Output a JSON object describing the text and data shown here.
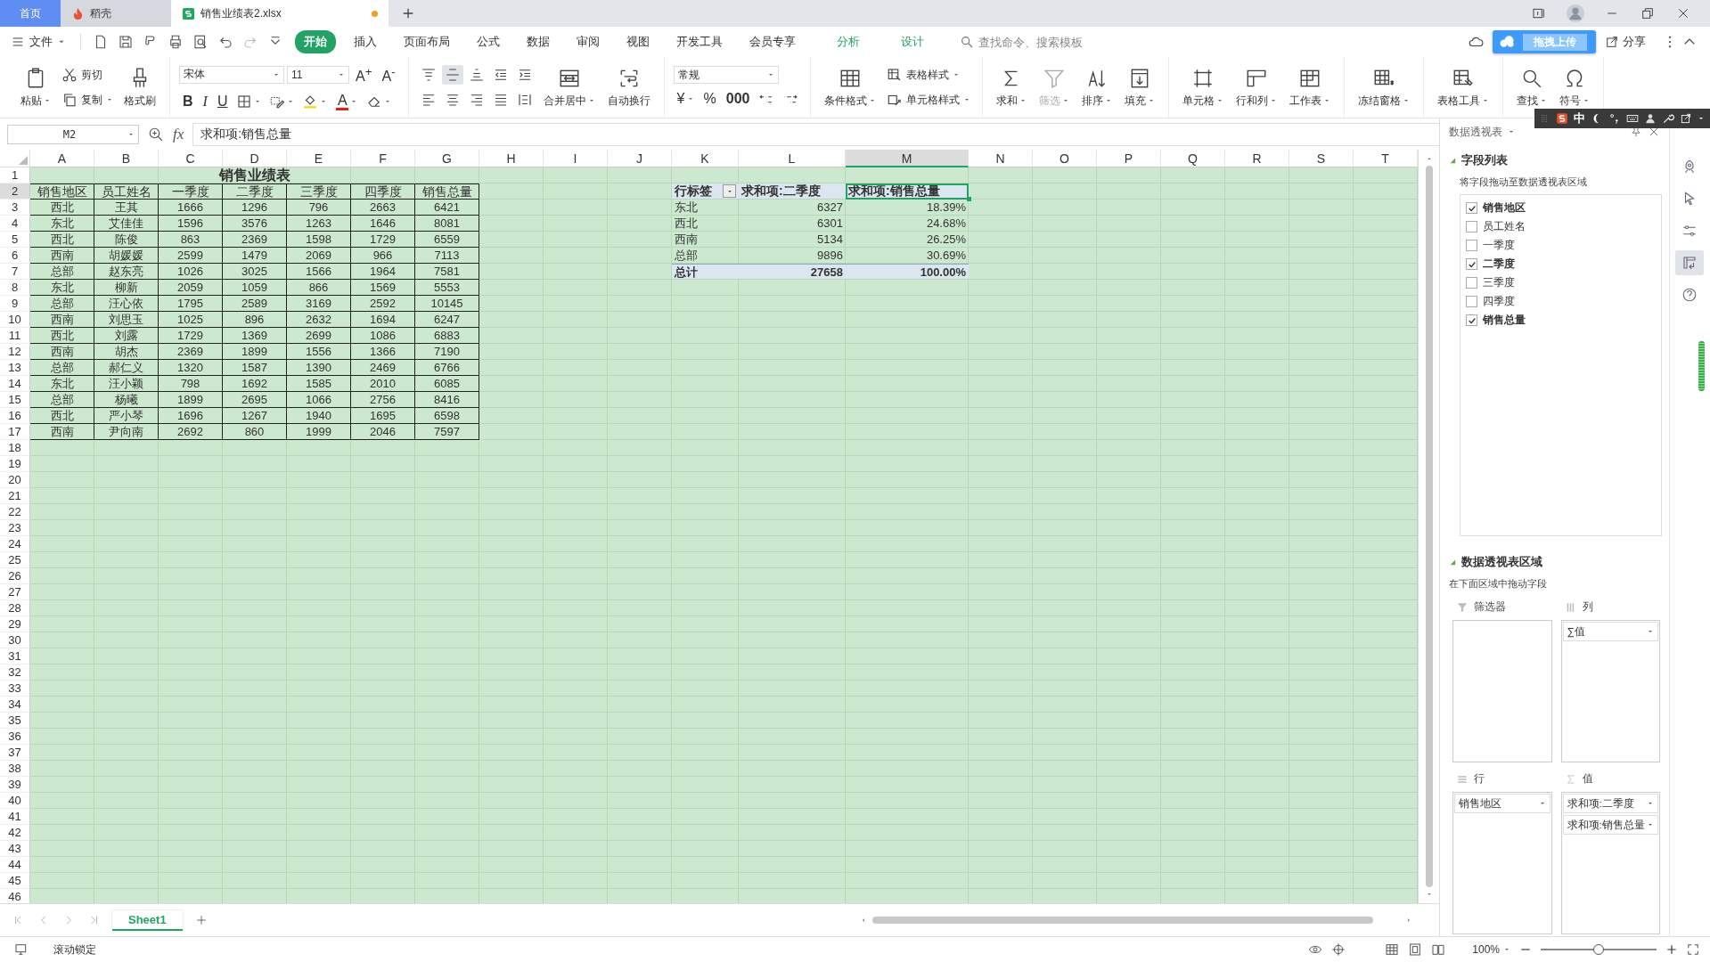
{
  "tabs": [
    {
      "label": "首页",
      "kind": "home",
      "selected": false
    },
    {
      "label": "稻壳",
      "kind": "docer",
      "selected": false
    },
    {
      "label": "销售业绩表2.xlsx",
      "kind": "sheet",
      "selected": true,
      "modified": true
    }
  ],
  "menu": {
    "file": "文件",
    "tabs": [
      {
        "label": "开始",
        "kind": "main",
        "selected": true
      },
      {
        "label": "插入",
        "kind": "main",
        "selected": false
      },
      {
        "label": "页面布局",
        "kind": "main",
        "selected": false
      },
      {
        "label": "公式",
        "kind": "main",
        "selected": false
      },
      {
        "label": "数据",
        "kind": "main",
        "selected": false
      },
      {
        "label": "审阅",
        "kind": "main",
        "selected": false
      },
      {
        "label": "视图",
        "kind": "main",
        "selected": false
      },
      {
        "label": "开发工具",
        "kind": "main",
        "selected": false
      },
      {
        "label": "会员专享",
        "kind": "main",
        "selected": false
      },
      {
        "label": "分析",
        "kind": "context",
        "selected": false
      },
      {
        "label": "设计",
        "kind": "context",
        "selected": false
      }
    ],
    "search": {
      "placeholder": "查找命令、搜索模板"
    },
    "upload": "拖拽上传",
    "share": "分享"
  },
  "ribbon": {
    "groups": [
      {
        "stacks": [
          [
            [
              {
                "kind": "large",
                "label": "粘贴",
                "dropdown": true
              }
            ]
          ],
          [
            [
              {
                "kind": "small",
                "label": "剪切",
                "dropdown": false
              }
            ],
            [
              {
                "kind": "small",
                "label": "复制",
                "dropdown": true
              }
            ]
          ],
          [
            [
              {
                "kind": "large",
                "label": "格式刷",
                "dropdown": false
              }
            ]
          ]
        ]
      },
      {
        "stacks": [
          [
            [
              {
                "kind": "select",
                "label": "宋体",
                "wide": true
              },
              {
                "kind": "select",
                "label": "11",
                "wide": false
              },
              {
                "kind": "char",
                "label": "A$^{+}$"
              },
              {
                "kind": "char",
                "label": "A$^{-}$"
              }
            ],
            [
              {
                "kind": "char",
                "label": "B"
              },
              {
                "kind": "char",
                "label": "I"
              },
              {
                "kind": "char",
                "label": "U"
              },
              {
                "kind": "icon",
                "dropdown": true
              },
              {
                "kind": "icon",
                "dropdown": true
              },
              {
                "kind": "icon",
                "dropdown": true
              },
              {
                "kind": "char",
                "label": "A",
                "color": "#e02020",
                "dropdown": true
              },
              {
                "kind": "icon",
                "dropdown": true
              }
            ]
          ]
        ]
      },
      {
        "stacks": [
          [
            [
              {
                "kind": "icon",
                "on": false
              },
              {
                "kind": "icon",
                "on": true
              },
              {
                "kind": "icon",
                "on": false
              },
              {
                "kind": "icon",
                "on": false
              },
              {
                "kind": "icon",
                "on": false
              }
            ],
            [
              {
                "kind": "icon",
                "on": false
              },
              {
                "kind": "icon",
                "on": false
              },
              {
                "kind": "icon",
                "on": false
              },
              {
                "kind": "icon",
                "on": false
              },
              {
                "kind": "icon",
                "on": false
              }
            ]
          ],
          [
            [
              {
                "kind": "large",
                "label": "合并居中",
                "dropdown": true
              }
            ]
          ],
          [
            [
              {
                "kind": "large",
                "label": "自动换行",
                "dropdown": false
              }
            ]
          ]
        ]
      },
      {
        "stacks": [
          [
            [
              {
                "kind": "select",
                "label": "常规",
                "wide": true
              }
            ],
            [
              {
                "kind": "char",
                "label": "¥",
                "dropdown": true
              },
              {
                "kind": "char",
                "label": "%"
              },
              {
                "kind": "char",
                "label": "000"
              },
              {
                "kind": "icon"
              },
              {
                "kind": "icon"
              }
            ]
          ]
        ]
      },
      {
        "stacks": [
          [
            [
              {
                "kind": "large",
                "label": "条件格式",
                "dropdown": true
              }
            ]
          ],
          [
            [
              {
                "kind": "small",
                "label": "表格样式",
                "dropdown": true
              }
            ],
            [
              {
                "kind": "small",
                "label": "单元格样式",
                "dropdown": true
              }
            ]
          ]
        ]
      },
      {
        "stacks": [
          [
            [
              {
                "kind": "large",
                "label": "求和",
                "dropdown": true,
                "disabled": false
              }
            ]
          ],
          [
            [
              {
                "kind": "large",
                "label": "筛选",
                "dropdown": true,
                "disabled": true
              }
            ]
          ],
          [
            [
              {
                "kind": "large",
                "label": "排序",
                "dropdown": true,
                "disabled": false
              }
            ]
          ],
          [
            [
              {
                "kind": "large",
                "label": "填充",
                "dropdown": true,
                "disabled": false
              }
            ]
          ]
        ]
      },
      {
        "stacks": [
          [
            [
              {
                "kind": "large",
                "label": "单元格",
                "dropdown": true
              }
            ]
          ],
          [
            [
              {
                "kind": "large",
                "label": "行和列",
                "dropdown": true
              }
            ]
          ],
          [
            [
              {
                "kind": "large",
                "label": "工作表",
                "dropdown": true
              }
            ]
          ]
        ]
      },
      {
        "stacks": [
          [
            [
              {
                "kind": "large",
                "label": "冻结窗格",
                "dropdown": true
              }
            ]
          ]
        ]
      },
      {
        "stacks": [
          [
            [
              {
                "kind": "large",
                "label": "表格工具",
                "dropdown": true
              }
            ]
          ]
        ]
      },
      {
        "stacks": [
          [
            [
              {
                "kind": "large",
                "label": "查找",
                "dropdown": true
              }
            ]
          ],
          [
            [
              {
                "kind": "large",
                "label": "符号",
                "dropdown": true
              }
            ]
          ]
        ]
      }
    ]
  },
  "formula_bar": {
    "cell": "M2",
    "fx": "fx",
    "value": "求和项:销售总量"
  },
  "sheet": {
    "columns": [
      {
        "label": "A",
        "selected": false
      },
      {
        "label": "B",
        "selected": false
      },
      {
        "label": "C",
        "selected": false
      },
      {
        "label": "D",
        "selected": false
      },
      {
        "label": "E",
        "selected": false
      },
      {
        "label": "F",
        "selected": false
      },
      {
        "label": "G",
        "selected": false
      },
      {
        "label": "H",
        "selected": false
      },
      {
        "label": "I",
        "selected": false
      },
      {
        "label": "J",
        "selected": false
      },
      {
        "label": "K",
        "selected": false
      },
      {
        "label": "L",
        "selected": false
      },
      {
        "label": "M",
        "selected": true
      },
      {
        "label": "N",
        "selected": false
      },
      {
        "label": "O",
        "selected": false
      },
      {
        "label": "P",
        "selected": false
      },
      {
        "label": "Q",
        "selected": false
      },
      {
        "label": "R",
        "selected": false
      },
      {
        "label": "S",
        "selected": false
      },
      {
        "label": "T",
        "selected": false
      }
    ],
    "rows": [
      {
        "label": "1",
        "selected": false
      },
      {
        "label": "2",
        "selected": true
      },
      {
        "label": "3",
        "selected": false
      },
      {
        "label": "4",
        "selected": false
      },
      {
        "label": "5",
        "selected": false
      },
      {
        "label": "6",
        "selected": false
      },
      {
        "label": "7",
        "selected": false
      },
      {
        "label": "8",
        "selected": false
      },
      {
        "label": "9",
        "selected": false
      },
      {
        "label": "10",
        "selected": false
      },
      {
        "label": "11",
        "selected": false
      },
      {
        "label": "12",
        "selected": false
      },
      {
        "label": "13",
        "selected": false
      },
      {
        "label": "14",
        "selected": false
      },
      {
        "label": "15",
        "selected": false
      },
      {
        "label": "16",
        "selected": false
      },
      {
        "label": "17",
        "selected": false
      },
      {
        "label": "18",
        "selected": false
      },
      {
        "label": "19",
        "selected": false
      },
      {
        "label": "20",
        "selected": false
      },
      {
        "label": "21",
        "selected": false
      },
      {
        "label": "22",
        "selected": false
      },
      {
        "label": "23",
        "selected": false
      },
      {
        "label": "24",
        "selected": false
      },
      {
        "label": "25",
        "selected": false
      },
      {
        "label": "26",
        "selected": false
      },
      {
        "label": "27",
        "selected": false
      },
      {
        "label": "28",
        "selected": false
      },
      {
        "label": "29",
        "selected": false
      },
      {
        "label": "30",
        "selected": false
      },
      {
        "label": "31",
        "selected": false
      },
      {
        "label": "32",
        "selected": false
      },
      {
        "label": "33",
        "selected": false
      },
      {
        "label": "34",
        "selected": false
      },
      {
        "label": "35",
        "selected": false
      },
      {
        "label": "36",
        "selected": false
      },
      {
        "label": "37",
        "selected": false
      },
      {
        "label": "38",
        "selected": false
      },
      {
        "label": "39",
        "selected": false
      },
      {
        "label": "40",
        "selected": false
      },
      {
        "label": "41",
        "selected": false
      },
      {
        "label": "42",
        "selected": false
      },
      {
        "label": "43",
        "selected": false
      },
      {
        "label": "44",
        "selected": false
      },
      {
        "label": "45",
        "selected": false
      },
      {
        "label": "46",
        "selected": false
      }
    ]
  },
  "table": {
    "title": "销售业绩表",
    "columns": [
      "销售地区",
      "员工姓名",
      "一季度",
      "二季度",
      "三季度",
      "四季度",
      "销售总量"
    ],
    "rows": [
      [
        "西北",
        "王其",
        "1666",
        "1296",
        "796",
        "2663",
        "6421"
      ],
      [
        "东北",
        "艾佳佳",
        "1596",
        "3576",
        "1263",
        "1646",
        "8081"
      ],
      [
        "西北",
        "陈俊",
        "863",
        "2369",
        "1598",
        "1729",
        "6559"
      ],
      [
        "西南",
        "胡媛媛",
        "2599",
        "1479",
        "2069",
        "966",
        "7113"
      ],
      [
        "总部",
        "赵东亮",
        "1026",
        "3025",
        "1566",
        "1964",
        "7581"
      ],
      [
        "东北",
        "柳新",
        "2059",
        "1059",
        "866",
        "1569",
        "5553"
      ],
      [
        "总部",
        "汪心依",
        "1795",
        "2589",
        "3169",
        "2592",
        "10145"
      ],
      [
        "西南",
        "刘思玉",
        "1025",
        "896",
        "2632",
        "1694",
        "6247"
      ],
      [
        "西北",
        "刘露",
        "1729",
        "1369",
        "2699",
        "1086",
        "6883"
      ],
      [
        "西南",
        "胡杰",
        "2369",
        "1899",
        "1556",
        "1366",
        "7190"
      ],
      [
        "总部",
        "郝仁义",
        "1320",
        "1587",
        "1390",
        "2469",
        "6766"
      ],
      [
        "东北",
        "汪小颖",
        "798",
        "1692",
        "1585",
        "2010",
        "6085"
      ],
      [
        "总部",
        "杨曦",
        "1899",
        "2695",
        "1066",
        "2756",
        "8416"
      ],
      [
        "西北",
        "严小琴",
        "1696",
        "1267",
        "1940",
        "1695",
        "6598"
      ],
      [
        "西南",
        "尹向南",
        "2692",
        "860",
        "1999",
        "2046",
        "7597"
      ]
    ]
  },
  "pivot": {
    "columns": [
      {
        "label": "行标签",
        "selected": false,
        "filter": true
      },
      {
        "label": "求和项:二季度",
        "selected": false,
        "filter": false
      },
      {
        "label": "求和项:销售总量",
        "selected": true,
        "filter": false
      }
    ],
    "rows": [
      [
        "东北",
        "6327",
        "18.39%"
      ],
      [
        "西北",
        "6301",
        "24.68%"
      ],
      [
        "西南",
        "5134",
        "26.25%"
      ],
      [
        "总部",
        "9896",
        "30.69%"
      ]
    ],
    "total": [
      "总计",
      "27658",
      "100.00%"
    ]
  },
  "pivot_panel": {
    "title": "数据透视表",
    "field_section": "字段列表",
    "field_hint": "将字段拖动至数据透视表区域",
    "fields": [
      {
        "label": "销售地区",
        "checked": true
      },
      {
        "label": "员工姓名",
        "checked": false
      },
      {
        "label": "一季度",
        "checked": false
      },
      {
        "label": "二季度",
        "checked": true
      },
      {
        "label": "三季度",
        "checked": false
      },
      {
        "label": "四季度",
        "checked": false
      },
      {
        "label": "销售总量",
        "checked": true
      }
    ],
    "area_section": "数据透视表区域",
    "area_hint": "在下面区域中拖动字段",
    "areas": [
      {
        "label": "筛选器",
        "kind": "filter"
      },
      {
        "label": "列",
        "kind": "columns",
        "items": [
          "∑值"
        ]
      },
      {
        "label": "行",
        "kind": "rows",
        "items": [
          "销售地区"
        ]
      },
      {
        "label": "值",
        "kind": "values",
        "items": [
          "求和项:二季度",
          "求和项:销售总量"
        ]
      }
    ]
  },
  "side_tools": [
    {
      "selected": false
    },
    {
      "selected": false
    },
    {
      "selected": false
    },
    {
      "selected": true
    },
    {
      "selected": false
    }
  ],
  "sheet_tabs": [
    {
      "label": "Sheet1",
      "selected": true
    }
  ],
  "status": {
    "text": "滚动锁定",
    "zoom": {
      "label": "100%",
      "level": 0.5
    }
  },
  "ime_bar": {
    "mode": "中"
  }
}
